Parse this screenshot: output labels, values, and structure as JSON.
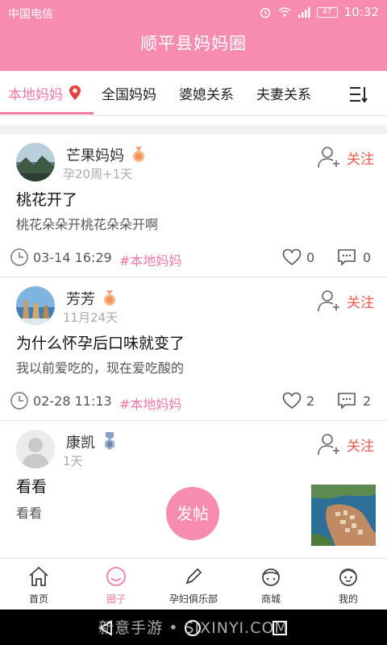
{
  "status": {
    "carrier": "中国电信",
    "time": "10:32",
    "battery": "47"
  },
  "app": {
    "title": "顺平县妈妈圈"
  },
  "tabs": [
    {
      "label": "本地妈妈",
      "active": true
    },
    {
      "label": "全国妈妈",
      "active": false
    },
    {
      "label": "婆媳关系",
      "active": false
    },
    {
      "label": "夫妻关系",
      "active": false
    }
  ],
  "posts": [
    {
      "username": "芒果妈妈",
      "subline": "孕20周+1天",
      "follow_label": "关注",
      "title": "桃花开了",
      "body": "桃花朵朵开桃花朵朵开啊",
      "time": "03-14 16:29",
      "tag": "#本地妈妈",
      "likes": "0",
      "comments": "0"
    },
    {
      "username": "芳芳",
      "subline": "11月24天",
      "follow_label": "关注",
      "title": "为什么怀孕后口味就变了",
      "body": "我以前爱吃的，现在爱吃酸的",
      "time": "02-28 11:13",
      "tag": "#本地妈妈",
      "likes": "2",
      "comments": "2"
    },
    {
      "username": "康凯",
      "subline": "1天",
      "follow_label": "关注",
      "title": "看看",
      "body": "看看"
    }
  ],
  "fab": {
    "label": "发帖"
  },
  "bottom_nav": [
    {
      "label": "首页",
      "icon": "home-icon",
      "active": false
    },
    {
      "label": "圈子",
      "icon": "circle-icon",
      "active": true
    },
    {
      "label": "孕妇俱乐部",
      "icon": "pencil-icon",
      "active": false
    },
    {
      "label": "商城",
      "icon": "shop-icon",
      "active": false
    },
    {
      "label": "我的",
      "icon": "profile-icon",
      "active": false
    }
  ],
  "watermark": "新意手游 • SJXINYI.COM",
  "colors": {
    "brand": "#f88bb0",
    "accent": "#f27aa5",
    "follow": "#f05a4f"
  }
}
